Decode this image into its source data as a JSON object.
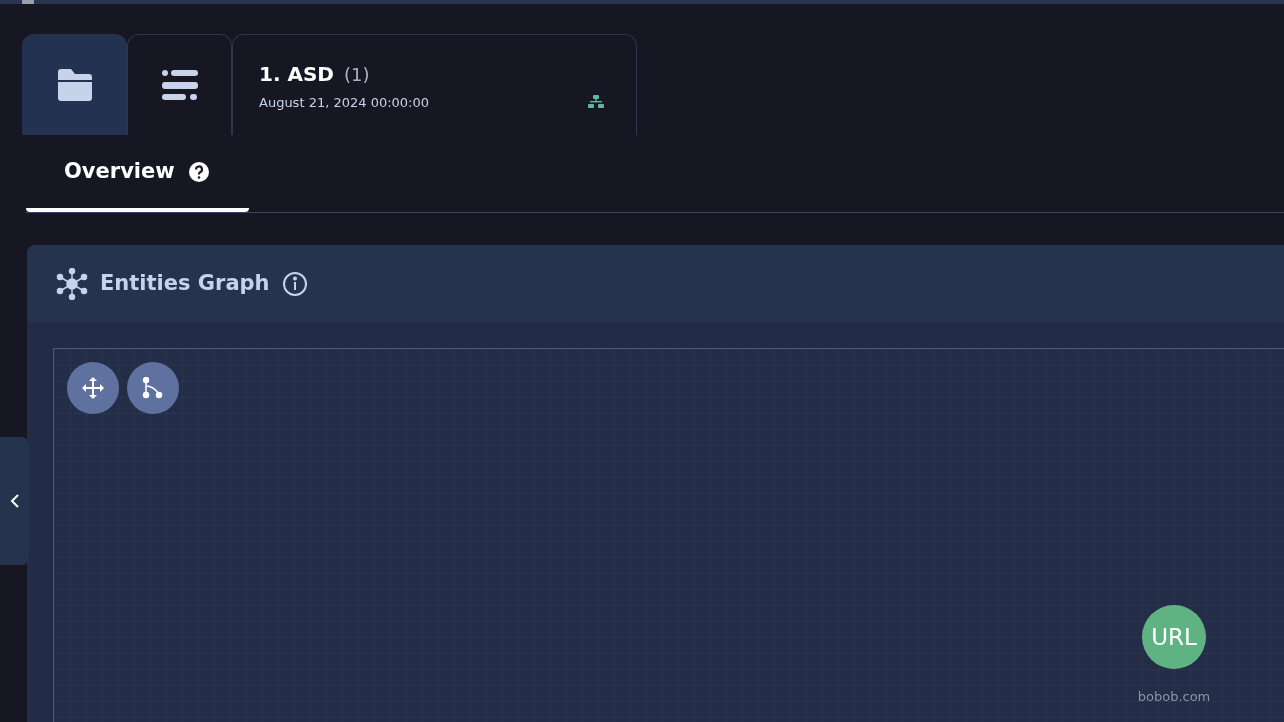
{
  "tabs": [
    {
      "kind": "folder",
      "selected": true
    },
    {
      "kind": "list",
      "selected": false
    },
    {
      "kind": "case",
      "title": "1. ASD",
      "count": "(1)",
      "date": "August 21, 2024 00:00:00",
      "selected": false
    }
  ],
  "subtabs": [
    {
      "label": "Overview",
      "selected": true
    }
  ],
  "panel": {
    "title": "Entities Graph",
    "tools": [
      {
        "kind": "move"
      },
      {
        "kind": "connect"
      }
    ],
    "nodes": [
      {
        "label": "URL",
        "caption": "bobob.com",
        "color": "#5fb383"
      }
    ]
  }
}
